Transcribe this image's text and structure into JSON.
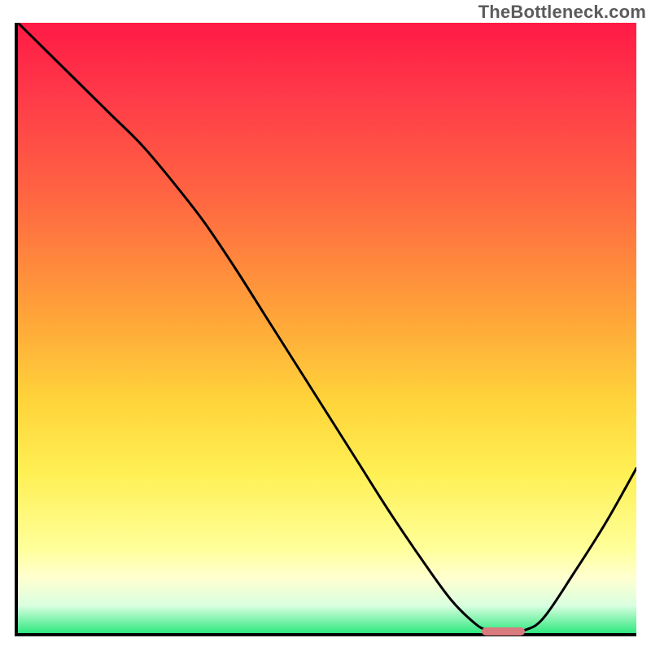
{
  "watermark": "TheBottleneck.com",
  "colors": {
    "border": "#000000",
    "watermark_text": "#5b5b5b",
    "marker": "#d97a7f",
    "curve": "#000000",
    "gradient_top": "#ff1a45",
    "gradient_bottom": "#2fe87f"
  },
  "chart_data": {
    "type": "line",
    "title": "",
    "xlabel": "",
    "ylabel": "",
    "xlim": [
      0,
      100
    ],
    "ylim": [
      0,
      100
    ],
    "grid": false,
    "legend": false,
    "series": [
      {
        "name": "bottleneck-curve",
        "x": [
          0,
          5,
          10,
          15,
          20,
          25,
          30,
          35,
          40,
          45,
          50,
          55,
          60,
          65,
          70,
          74,
          76,
          78,
          80,
          82,
          85,
          90,
          95,
          100
        ],
        "y": [
          100,
          95,
          90,
          85,
          80,
          74,
          67.5,
          60,
          52,
          44,
          36,
          28,
          20,
          12.5,
          5.5,
          1.5,
          0.5,
          0.3,
          0.3,
          0.5,
          2.5,
          10,
          18,
          27
        ]
      }
    ],
    "annotations": [
      {
        "name": "optimal-flat",
        "type": "segment",
        "x_start": 75,
        "x_end": 82,
        "y": 0.3
      }
    ],
    "background": "vertical-gradient red→orange→yellow→pale→green"
  }
}
